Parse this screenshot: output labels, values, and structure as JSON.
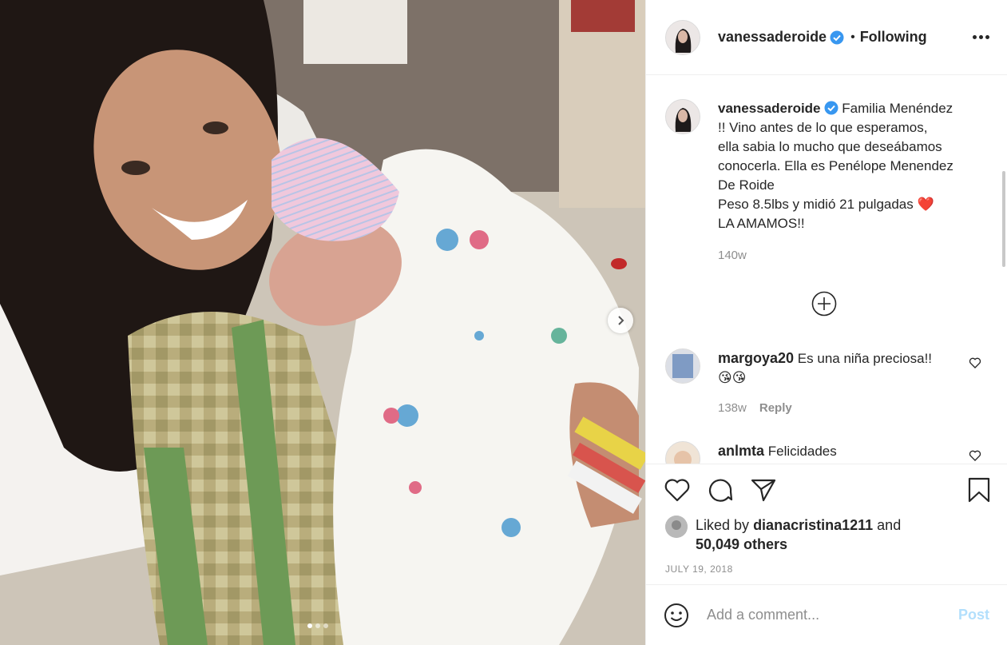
{
  "post": {
    "username": "vanessaderoide",
    "verified": true,
    "bullet": "•",
    "follow_status": "Following",
    "more_icon": "more-horizontal-icon"
  },
  "caption": {
    "username": "vanessaderoide",
    "lines": [
      "Familia Menéndez",
      "!! Vino antes de lo que esperamos,",
      "ella sabia lo mucho que deseábamos",
      "conocerla. Ella es Penélope Menendez",
      "De Roide",
      "Peso 8.5lbs y midió 21 pulgadas",
      "LA AMAMOS!!"
    ],
    "emoji": "❤️",
    "time": "140w"
  },
  "comments": [
    {
      "username": "margoya20",
      "text": "Es una niña preciosa!!",
      "emoji": "😘😘",
      "time": "138w",
      "reply_label": "Reply"
    },
    {
      "username": "anlmta",
      "text": "Felicidades"
    }
  ],
  "likes": {
    "prefix": "Liked by",
    "user": "dianacristina1211",
    "conjunction": "and",
    "others": "50,049 others"
  },
  "date": "JULY 19, 2018",
  "add_comment": {
    "placeholder": "Add a comment...",
    "post_label": "Post"
  },
  "carousel": {
    "total": 3,
    "current": 1
  },
  "colors": {
    "verified": "#3897f0",
    "post_button": "#b2dffc",
    "heart": "#e0245e"
  }
}
